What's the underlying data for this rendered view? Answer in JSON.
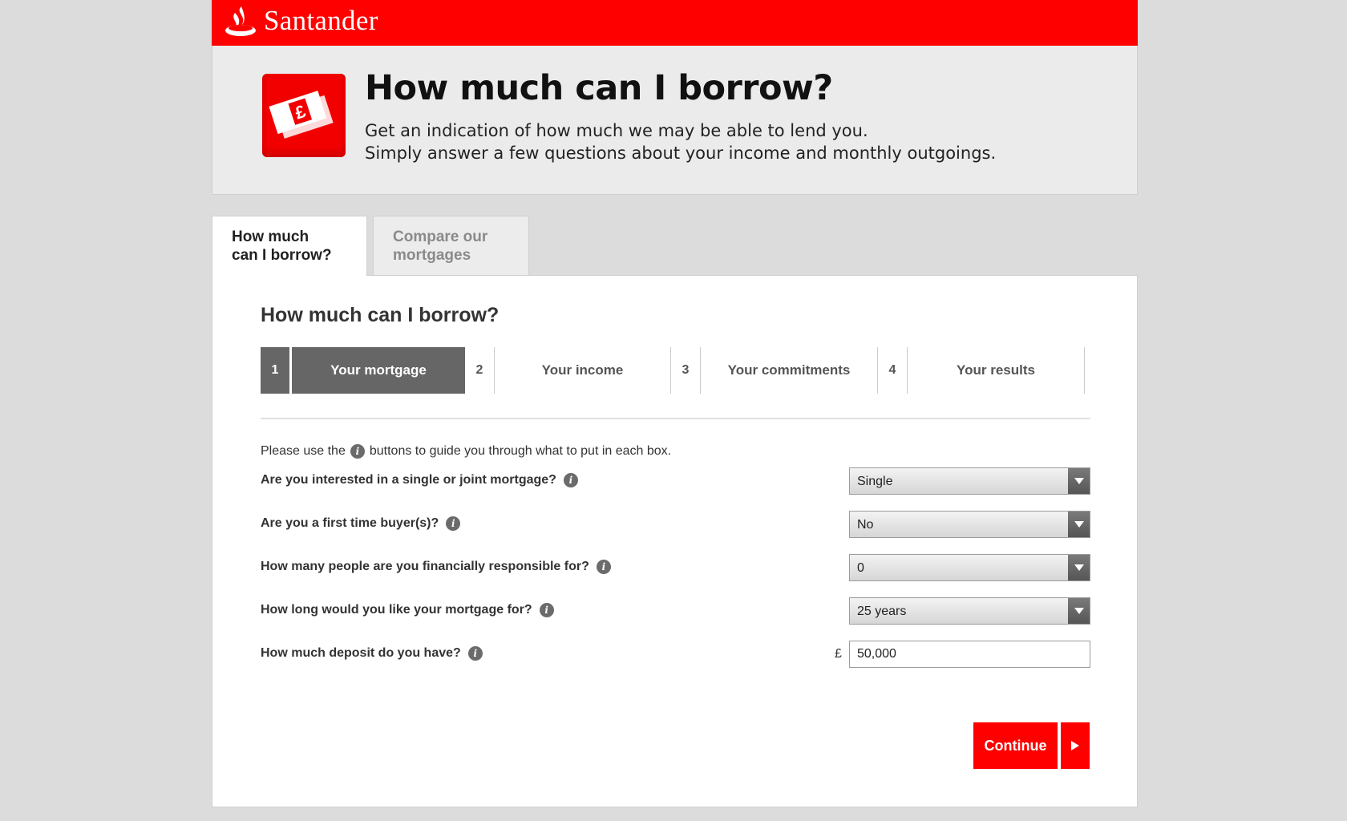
{
  "brand": {
    "name": "Santander",
    "icon": "flame-logo-icon"
  },
  "hero": {
    "icon": "banknotes-pound-icon",
    "title": "How much can I borrow?",
    "subtitle_line1": "Get an indication of how much we may be able to lend you.",
    "subtitle_line2": "Simply answer a few questions about your income and monthly outgoings."
  },
  "tabs": [
    {
      "label_line1": "How much",
      "label_line2": "can I borrow?",
      "active": true
    },
    {
      "label_line1": "Compare our",
      "label_line2": "mortgages",
      "active": false
    }
  ],
  "panel": {
    "title": "How much can I borrow?",
    "steps": [
      {
        "num": "1",
        "label": "Your mortgage",
        "active": true
      },
      {
        "num": "2",
        "label": "Your income",
        "active": false
      },
      {
        "num": "3",
        "label": "Your commitments",
        "active": false
      },
      {
        "num": "4",
        "label": "Your results",
        "active": false
      }
    ],
    "hint_before": "Please use the",
    "hint_after": "buttons to guide you through what to put in each box.",
    "info_glyph": "i",
    "questions": [
      {
        "label": "Are you interested in a single or joint mortgage?",
        "value": "Single"
      },
      {
        "label": "Are you a first time buyer(s)?",
        "value": "No"
      },
      {
        "label": "How many people are you financially responsible for?",
        "value": "0"
      },
      {
        "label": "How long would you like your mortgage for?",
        "value": "25 years"
      },
      {
        "label": "How much deposit do you have?",
        "currency": "£",
        "value": "50,000"
      }
    ],
    "continue_label": "Continue"
  },
  "colors": {
    "brand_red": "#fe0000",
    "step_active": "#666666",
    "page_bg": "#dcdcdc"
  }
}
